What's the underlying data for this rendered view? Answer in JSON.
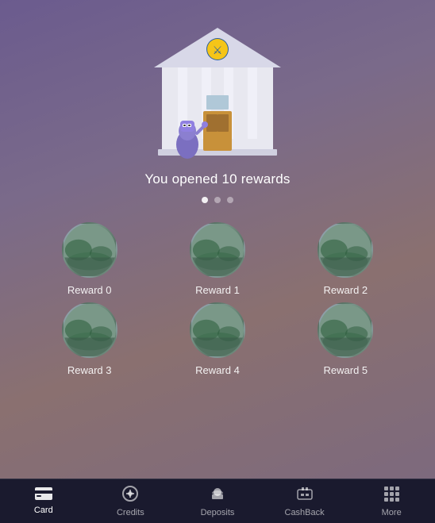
{
  "main": {
    "reward_text": "You opened 10 rewards",
    "dots": [
      {
        "active": true
      },
      {
        "active": false
      },
      {
        "active": false
      }
    ],
    "rewards": [
      {
        "label": "Reward 0"
      },
      {
        "label": "Reward 1"
      },
      {
        "label": "Reward 2"
      },
      {
        "label": "Reward 3"
      },
      {
        "label": "Reward 4"
      },
      {
        "label": "Reward 5"
      }
    ]
  },
  "tabbar": {
    "tabs": [
      {
        "id": "card",
        "label": "Card",
        "active": true
      },
      {
        "id": "credits",
        "label": "Credits",
        "active": false
      },
      {
        "id": "deposits",
        "label": "Deposits",
        "active": false
      },
      {
        "id": "cashback",
        "label": "CashBack",
        "active": false
      },
      {
        "id": "more",
        "label": "More",
        "active": false
      }
    ]
  }
}
